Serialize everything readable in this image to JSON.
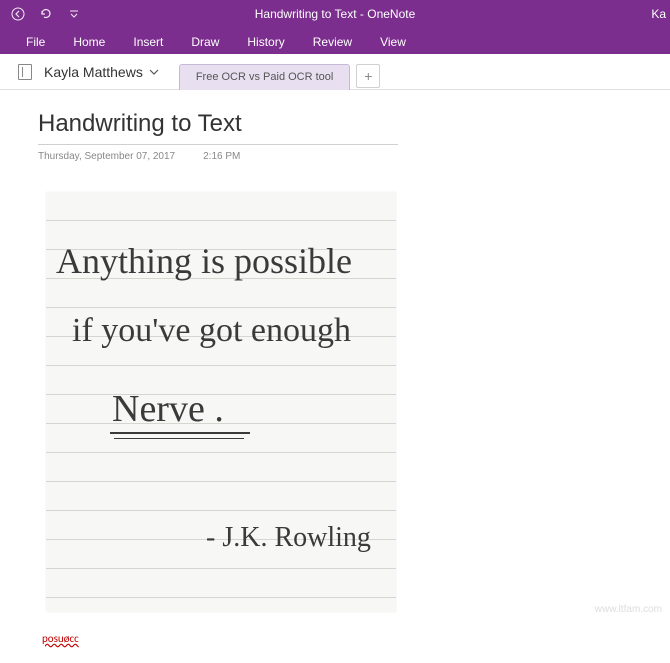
{
  "titlebar": {
    "window_title": "Handwriting to Text  -  OneNote",
    "user_snippet": "Ka"
  },
  "ribbon": {
    "tabs": [
      "File",
      "Home",
      "Insert",
      "Draw",
      "History",
      "Review",
      "View"
    ]
  },
  "nav": {
    "notebook_name": "Kayla Matthews",
    "page_tab": "Free OCR vs Paid OCR tool",
    "add_tab": "+"
  },
  "page": {
    "title": "Handwriting to Text",
    "date": "Thursday, September 07, 2017",
    "time": "2:16 PM"
  },
  "handwriting": {
    "line1": "Anything is possible",
    "line2": "if you've got enough",
    "line3": "Nerve .",
    "line4": "- J.K. Rowling"
  },
  "ocr_output": "posuøcc",
  "watermark": "www.ltfam.com"
}
